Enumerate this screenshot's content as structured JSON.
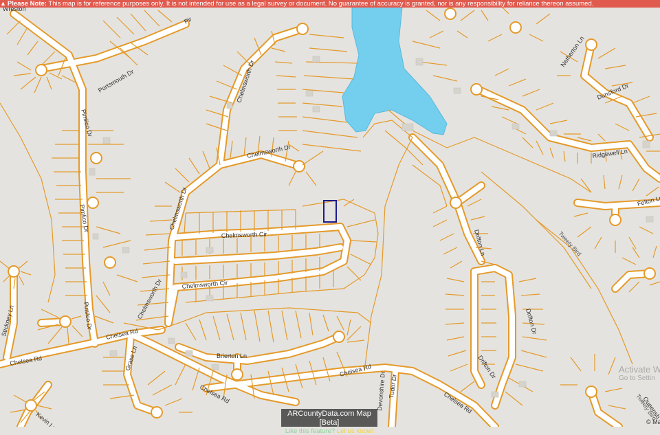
{
  "banner": {
    "icon": "warning-icon",
    "heading": "Please Note:",
    "text": "This map is for reference purposes only. It is not intended for use as a legal survey or document. No guarantee of accuracy is granted, nor is any responsibility for reliance thereon assumed."
  },
  "streets": {
    "wreston": "Wreston",
    "portsmouth": "Portsmouth Dr",
    "pimlico_1": "Pimlico Dr",
    "pimlico_2": "Pimlico Dr",
    "chelmsworth_dr_1": "Chelmsworth Dr",
    "chelmsworth_dr_2": "Chelmsworth Dr",
    "chelmsworth_dr_3": "Chelmsworth Dr",
    "chelmsworth_dr_4": "Chelmsworth Dr",
    "chelmsworth_cir_1": "Chelmsworth Cir",
    "chelmsworth_cir_2": "Chelmsworth Cir",
    "chelsea_1": "Chelsea Rd",
    "chelsea_2": "Chelsea Rd",
    "chelsea_3": "Chelsea Rd",
    "chelsea_4": "Chelsea Rd",
    "chelsea_5": "Chelsea Rd",
    "brierton": "Brierton Ln",
    "grase": "Grase Ln",
    "stickney": "Stickney Ln",
    "kevin": "Kevin Ln",
    "devonshire": "Devonshire Dr",
    "tudor": "Tudor Dr",
    "netherton": "Netherton Ln",
    "dunsford": "Dunsford Dr",
    "ridgewell": "Ridgewell Ln",
    "felton": "Felton Ln",
    "tweety": "Tweety Bird",
    "tweety_2": "Tweety Bird",
    "drifton_1": "Drifton Ln",
    "drifton_2": "Drifton Dr",
    "drifton_3": "Drifton Dr",
    "queensbury": "Queensb",
    "pirbright": "Pir"
  },
  "badge": {
    "title": "ARCountyData.com Map [Beta]",
    "feedback_prefix": "Like this feature?",
    "feedback_link": "Let us know!"
  },
  "watermark": {
    "line1": "Activate W",
    "line2": "Go to Settin"
  },
  "copyright": "© Ma",
  "colors": {
    "banner": "#e05a4e",
    "parcel_line": "#e49a2a",
    "road": "#ffffff",
    "water": "#74cfee",
    "land": "#e5e3df",
    "selected_parcel": "#1a1a8c"
  }
}
